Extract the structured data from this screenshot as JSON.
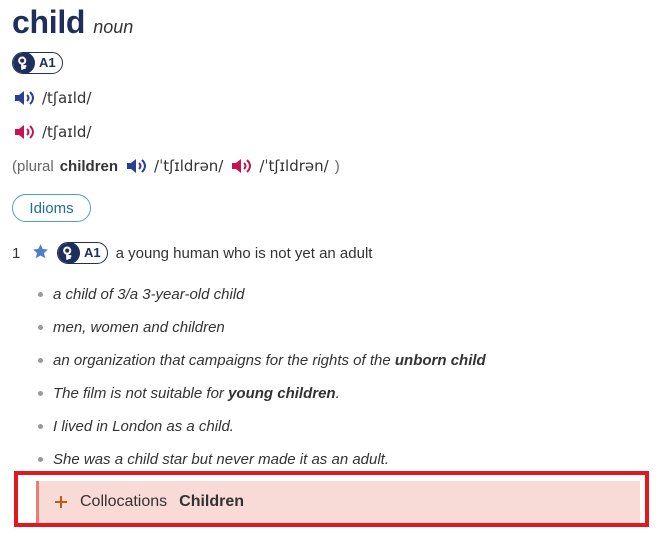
{
  "entry": {
    "headword": "child",
    "part_of_speech": "noun",
    "level": "A1",
    "pronunciation_uk": "/tʃaɪld/",
    "pronunciation_us": "/tʃaɪld/",
    "plural": {
      "open_paren": "(plural",
      "word": "children",
      "uk": "/ˈtʃɪldrən/",
      "us": "/ˈtʃɪldrən/",
      "close_paren": ")"
    }
  },
  "buttons": {
    "idioms": "Idioms"
  },
  "sense": {
    "number": "1",
    "level": "A1",
    "definition": "a young human who is not yet an adult",
    "examples": [
      {
        "text": "a child of 3/a 3-year-old child"
      },
      {
        "text": "men, women and children"
      },
      {
        "prefix": "an organization that campaigns for the rights of the ",
        "bold": "unborn child"
      },
      {
        "prefix": "The film is not suitable for ",
        "bold": "young children",
        "suffix": "."
      },
      {
        "text": "I lived in London as a child."
      },
      {
        "text": "She was a child star but never made it as an adult."
      }
    ]
  },
  "collocations": {
    "label": "Collocations",
    "title": "Children"
  },
  "colors": {
    "navy": "#1f2f5b",
    "uk_speaker": "#2a3f93",
    "us_speaker": "#c8124f",
    "idioms_border": "#4aa0c8",
    "highlight": "#e2181f",
    "collocation_bg": "#f8dbd7",
    "plus": "#c35b13",
    "star": "#4d7fc8"
  },
  "icons": {
    "key": "key-icon",
    "speaker_uk": "speaker-icon",
    "speaker_us": "speaker-icon",
    "star": "star-icon",
    "plus": "plus-icon"
  }
}
